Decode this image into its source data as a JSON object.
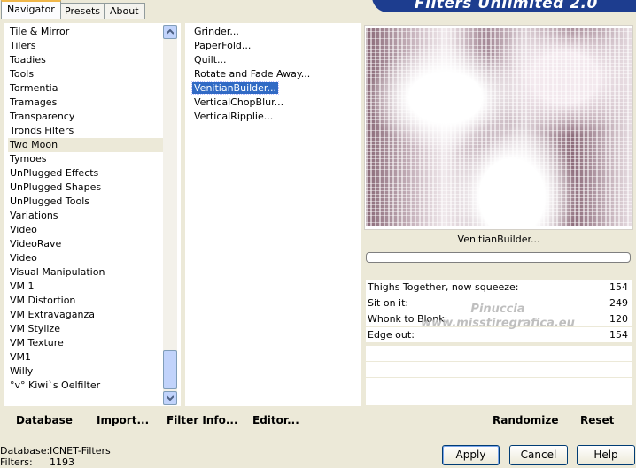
{
  "tabs": [
    "Navigator",
    "Presets",
    "About"
  ],
  "banner_title": "Filters Unlimited 2.0",
  "categories": [
    "Tile & Mirror",
    "Tilers",
    "Toadies",
    "Tools",
    "Tormentia",
    "Tramages",
    "Transparency",
    "Tronds Filters",
    "Two Moon",
    "Tymoes",
    "UnPlugged Effects",
    "UnPlugged Shapes",
    "UnPlugged Tools",
    "Variations",
    "Video",
    "VideoRave",
    "Video",
    "Visual Manipulation",
    "VM 1",
    "VM Distortion",
    "VM Extravaganza",
    "VM Stylize",
    "VM Texture",
    "VM1",
    "Willy",
    "°v° Kiwi`s Oelfilter"
  ],
  "selected_category": "Two Moon",
  "filters": [
    "Grinder...",
    "PaperFold...",
    "Quilt...",
    "Rotate and Fade Away...",
    "VenitianBuilder...",
    "VerticalChopBlur...",
    "VerticalRipplie..."
  ],
  "selected_filter": "VenitianBuilder...",
  "preview_filter_name": "VenitianBuilder...",
  "params": [
    {
      "label": "Thighs Together, now squeeze:",
      "value": "154"
    },
    {
      "label": "Sit on it:",
      "value": "249"
    },
    {
      "label": "Whonk to Blonk:",
      "value": "120"
    },
    {
      "label": "Edge out:",
      "value": "154"
    }
  ],
  "watermark": {
    "line1": "Pinuccia",
    "line2": "www.misstiregrafica.eu"
  },
  "bottom_buttons": {
    "database": "Database",
    "import": "Import...",
    "filter_info": "Filter Info...",
    "editor": "Editor...",
    "randomize": "Randomize",
    "reset": "Reset"
  },
  "status": {
    "database_label": "Database:",
    "database_value": "ICNET-Filters",
    "filters_label": "Filters:",
    "filters_value": "1193"
  },
  "dialog_buttons": {
    "apply": "Apply",
    "cancel": "Cancel",
    "help": "Help"
  }
}
